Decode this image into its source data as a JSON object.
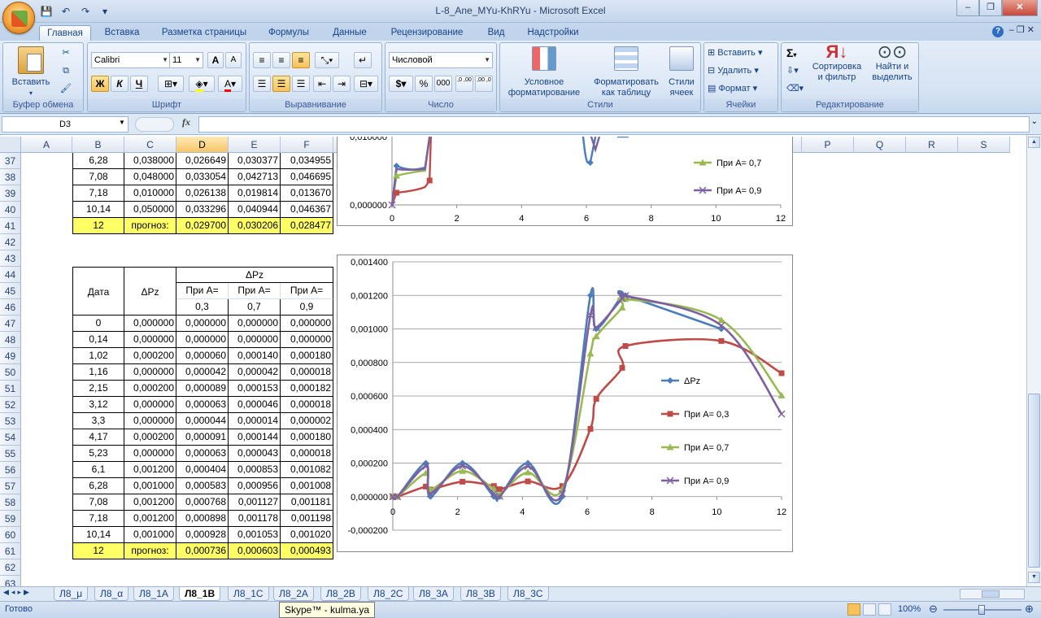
{
  "window": {
    "title": "L-8_Ane_MYu-KhRYu - Microsoft Excel",
    "controls": [
      "–",
      "❐",
      "✕"
    ]
  },
  "ribbon_tabs": [
    "Главная",
    "Вставка",
    "Разметка страницы",
    "Формулы",
    "Данные",
    "Рецензирование",
    "Вид",
    "Надстройки"
  ],
  "ribbon": {
    "clipboard": {
      "paste": "Вставить",
      "label": "Буфер обмена"
    },
    "font": {
      "name": "Calibri",
      "size": "11",
      "bold": "Ж",
      "italic": "К",
      "underline": "Ч",
      "label": "Шрифт"
    },
    "alignment": {
      "label": "Выравнивание"
    },
    "number": {
      "format": "Числовой",
      "currency": "$",
      "percent": "%",
      "thousands": "000",
      "inc": ",0 ,00",
      "dec": ",00 ,0",
      "label": "Число"
    },
    "styles": {
      "cond": "Условное форматирование",
      "table": "Форматировать как таблицу",
      "cell": "Стили ячеек",
      "label": "Стили"
    },
    "cells": {
      "insert": "Вставить",
      "delete": "Удалить",
      "format": "Формат",
      "label": "Ячейки"
    },
    "editing": {
      "sum": "Σ",
      "sort": "Сортировка и фильтр",
      "find": "Найти и выделить",
      "label": "Редактирование"
    }
  },
  "formula_bar": {
    "name_box": "D3",
    "fx": "fx",
    "formula": ""
  },
  "columns": [
    "A",
    "B",
    "C",
    "D",
    "E",
    "F",
    "G",
    "H",
    "I",
    "J",
    "K",
    "L",
    "M",
    "N",
    "O",
    "P",
    "Q",
    "R",
    "S"
  ],
  "row_numbers": [
    "37",
    "38",
    "39",
    "40",
    "41",
    "42",
    "43",
    "44",
    "45",
    "46",
    "47",
    "48",
    "49",
    "50",
    "51",
    "52",
    "53",
    "54",
    "55",
    "56",
    "57",
    "58",
    "59",
    "60",
    "61",
    "62",
    "63"
  ],
  "top_table": [
    [
      "6,28",
      "0,038000",
      "0,026649",
      "0,030377",
      "0,034955"
    ],
    [
      "7,08",
      "0,048000",
      "0,033054",
      "0,042713",
      "0,046695"
    ],
    [
      "7,18",
      "0,010000",
      "0,026138",
      "0,019814",
      "0,013670"
    ],
    [
      "10,14",
      "0,050000",
      "0,033296",
      "0,040944",
      "0,046367"
    ],
    [
      "12",
      "прогноз:",
      "0,029700",
      "0,030206",
      "0,028477"
    ]
  ],
  "bottom_table": {
    "h_date": "Дата",
    "h_dpz": "ΔPz",
    "h_group": "ΔPz",
    "h_a03_1": "При А=",
    "h_a03_2": "0,3",
    "h_a07_1": "При А=",
    "h_a07_2": "0,7",
    "h_a09_1": "При А=",
    "h_a09_2": "0,9",
    "rows": [
      [
        "0",
        "0,000000",
        "0,000000",
        "0,000000",
        "0,000000"
      ],
      [
        "0,14",
        "0,000000",
        "0,000000",
        "0,000000",
        "0,000000"
      ],
      [
        "1,02",
        "0,000200",
        "0,000060",
        "0,000140",
        "0,000180"
      ],
      [
        "1,16",
        "0,000000",
        "0,000042",
        "0,000042",
        "0,000018"
      ],
      [
        "2,15",
        "0,000200",
        "0,000089",
        "0,000153",
        "0,000182"
      ],
      [
        "3,12",
        "0,000000",
        "0,000063",
        "0,000046",
        "0,000018"
      ],
      [
        "3,3",
        "0,000000",
        "0,000044",
        "0,000014",
        "0,000002"
      ],
      [
        "4,17",
        "0,000200",
        "0,000091",
        "0,000144",
        "0,000180"
      ],
      [
        "5,23",
        "0,000000",
        "0,000063",
        "0,000043",
        "0,000018"
      ],
      [
        "6,1",
        "0,001200",
        "0,000404",
        "0,000853",
        "0,001082"
      ],
      [
        "6,28",
        "0,001000",
        "0,000583",
        "0,000956",
        "0,001008"
      ],
      [
        "7,08",
        "0,001200",
        "0,000768",
        "0,001127",
        "0,001181"
      ],
      [
        "7,18",
        "0,001200",
        "0,000898",
        "0,001178",
        "0,001198"
      ],
      [
        "10,14",
        "0,001000",
        "0,000928",
        "0,001053",
        "0,001020"
      ],
      [
        "12",
        "прогноз:",
        "0,000736",
        "0,000603",
        "0,000493"
      ]
    ]
  },
  "chart_data": [
    {
      "type": "line",
      "xlim": [
        0,
        12
      ],
      "x_ticks": [
        "0",
        "2",
        "4",
        "6",
        "8",
        "10",
        "12"
      ],
      "y_ticks": [
        "0,000000"
      ],
      "y_top_label": "0,010000",
      "legend": [
        "При А= 0,7",
        "При А= 0,9"
      ],
      "colors": {
        "dpz": "#4a7ebb",
        "a03": "#be4b48",
        "a07": "#98b954",
        "a09": "#7d60a0"
      }
    },
    {
      "type": "line",
      "xlim": [
        0,
        12
      ],
      "ylim": [
        -0.0002,
        0.0014
      ],
      "x_ticks": [
        "0",
        "2",
        "4",
        "6",
        "8",
        "10",
        "12"
      ],
      "y_ticks": [
        "0,001400",
        "0,001200",
        "0,001000",
        "0,000800",
        "0,000600",
        "0,000400",
        "0,000200",
        "0,000000",
        "-0,000200"
      ],
      "x": [
        0,
        0.14,
        1.02,
        1.16,
        2.15,
        3.12,
        3.3,
        4.17,
        5.23,
        6.1,
        6.28,
        7.08,
        7.18,
        10.14,
        12
      ],
      "series": [
        {
          "name": "ΔPz",
          "color": "#4a7ebb",
          "marker": "diamond",
          "values": [
            0,
            0,
            0.0002,
            0,
            0.0002,
            0,
            0,
            0.0002,
            0,
            0.0012,
            0.001,
            0.0012,
            0.0012,
            0.001,
            null
          ]
        },
        {
          "name": "При А= 0,3",
          "color": "#be4b48",
          "marker": "square",
          "values": [
            0,
            0,
            6e-05,
            4.2e-05,
            8.9e-05,
            6.3e-05,
            4.4e-05,
            9.1e-05,
            6.3e-05,
            0.000404,
            0.000583,
            0.000768,
            0.000898,
            0.000928,
            0.000736
          ]
        },
        {
          "name": "При А= 0,7",
          "color": "#98b954",
          "marker": "triangle",
          "values": [
            0,
            0,
            0.00014,
            4.2e-05,
            0.000153,
            4.6e-05,
            1.4e-05,
            0.000144,
            4.3e-05,
            0.000853,
            0.000956,
            0.001127,
            0.001178,
            0.001053,
            0.000603
          ]
        },
        {
          "name": "При А= 0,9",
          "color": "#7d60a0",
          "marker": "x",
          "values": [
            0,
            0,
            0.00018,
            1.8e-05,
            0.000182,
            1.8e-05,
            2e-06,
            0.00018,
            1.8e-05,
            0.001082,
            0.001008,
            0.001181,
            0.001198,
            0.00102,
            0.000493
          ]
        }
      ]
    }
  ],
  "sheet_tabs": [
    "Л8_μ",
    "Л8_α",
    "Л8_1А",
    "Л8_1В",
    "Л8_1С",
    "Л8_2А",
    "Л8_2В",
    "Л8_2С",
    "Л8_3А",
    "Л8_3В",
    "Л8_3С"
  ],
  "active_sheet": "Л8_1В",
  "status": {
    "ready": "Готово",
    "zoom": "100%"
  },
  "tooltip": "Skype™ - kulma.ya"
}
